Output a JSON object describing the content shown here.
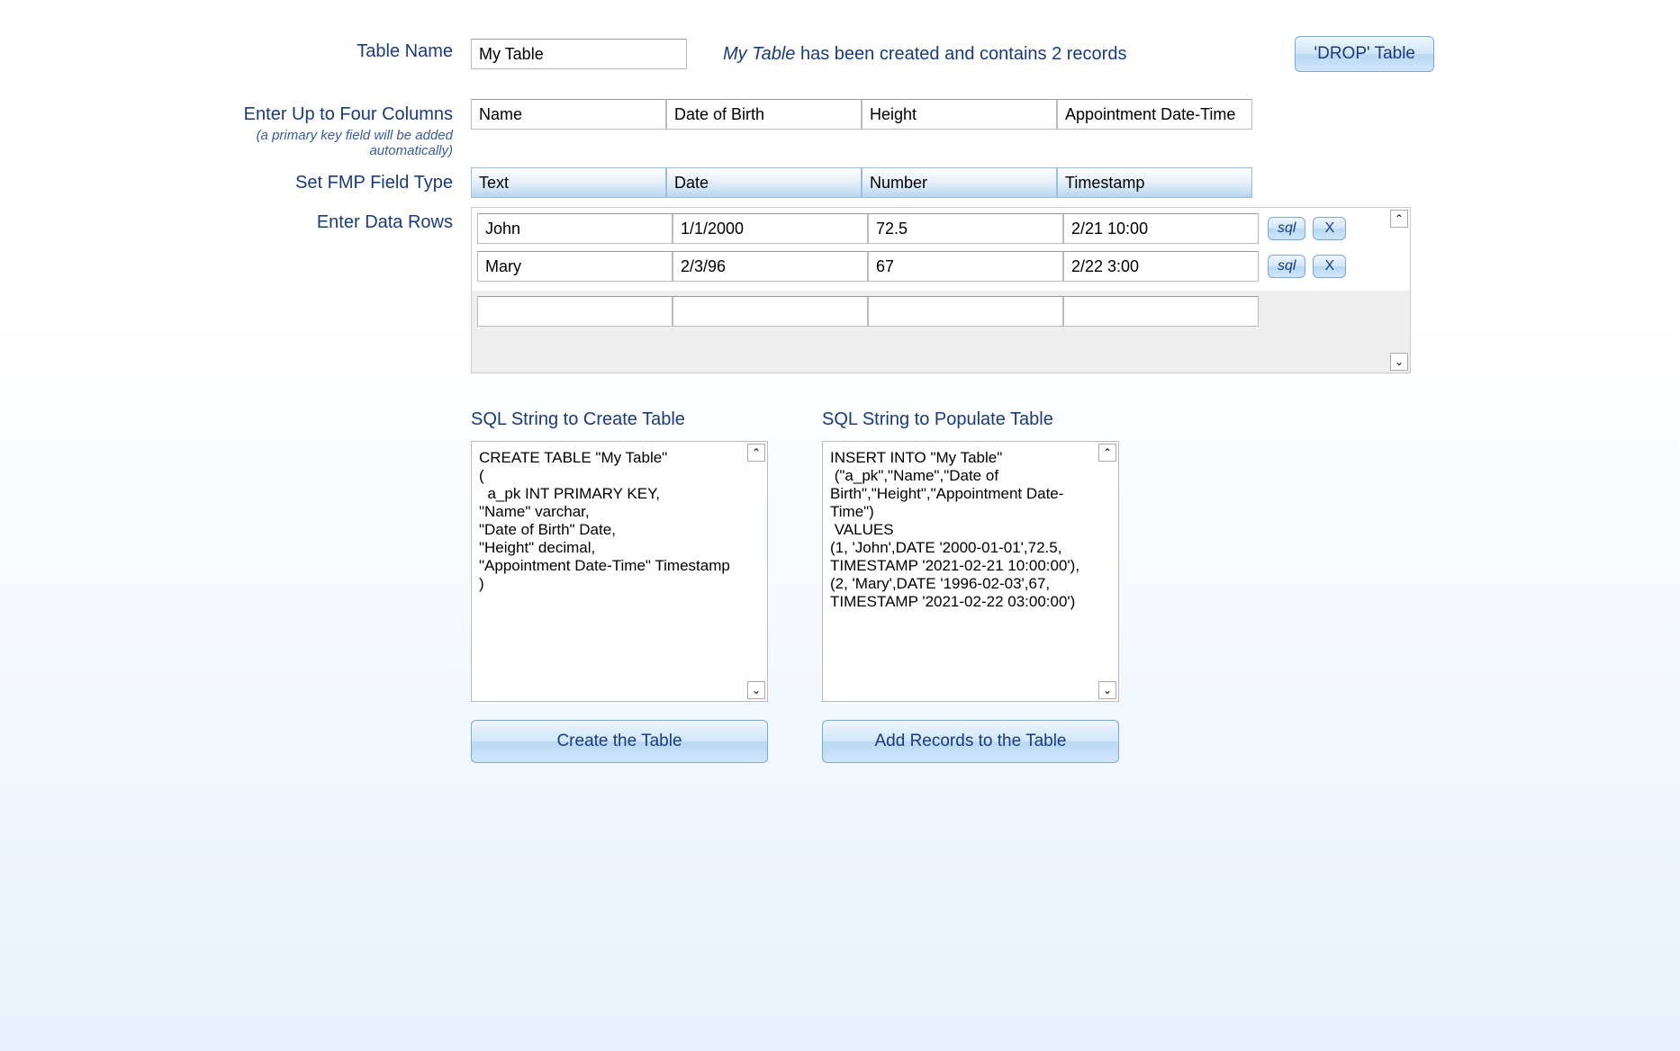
{
  "labels": {
    "table_name": "Table Name",
    "enter_columns": "Enter Up to Four Columns",
    "enter_columns_sub": "(a primary key field will be added automatically)",
    "field_type": "Set  FMP Field Type",
    "data_rows": "Enter Data Rows"
  },
  "table_name_value": "My Table",
  "status": {
    "prefix_italic": "My Table",
    "rest": " has been created and contains 2 records"
  },
  "drop_button": "'DROP' Table",
  "columns": [
    "Name",
    "Date of Birth",
    "Height",
    "Appointment Date-Time"
  ],
  "types": [
    "Text",
    "Date",
    "Number",
    "Timestamp"
  ],
  "rows": [
    {
      "cells": [
        "John",
        "1/1/2000",
        "72.5",
        "2/21 10:00"
      ]
    },
    {
      "cells": [
        "Mary",
        "2/3/96",
        "67",
        "2/22 3:00"
      ]
    }
  ],
  "row_buttons": {
    "sql": "sql",
    "x": "X"
  },
  "sql_create": {
    "heading": "SQL String to Create Table",
    "text": "CREATE TABLE \"My Table\"\n(\n  a_pk INT PRIMARY KEY,\n\"Name\" varchar,\n\"Date of Birth\" Date,\n\"Height\" decimal,\n\"Appointment Date-Time\" Timestamp\n)",
    "button": "Create the Table"
  },
  "sql_populate": {
    "heading": "SQL String to Populate Table",
    "text": "INSERT INTO \"My Table\"\n (\"a_pk\",\"Name\",\"Date of Birth\",\"Height\",\"Appointment Date-Time\")\n VALUES\n(1, 'John',DATE '2000-01-01',72.5, TIMESTAMP '2021-02-21 10:00:00'),\n(2, 'Mary',DATE '1996-02-03',67, TIMESTAMP '2021-02-22 03:00:00')",
    "button": "Add Records to the Table"
  }
}
